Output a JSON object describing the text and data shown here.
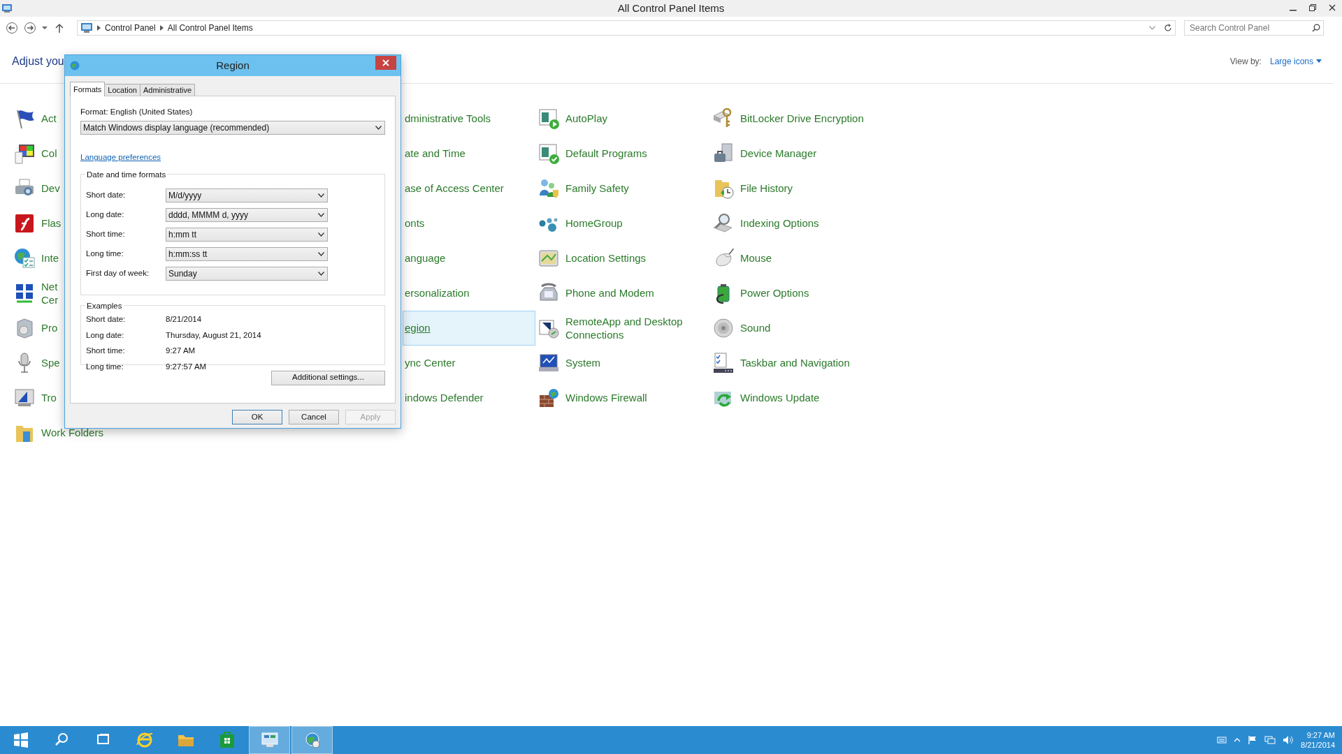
{
  "window": {
    "title": "All Control Panel Items"
  },
  "address_bar": {
    "breadcrumbs": [
      "Control Panel",
      "All Control Panel Items"
    ]
  },
  "search": {
    "placeholder": "Search Control Panel"
  },
  "header": {
    "title": "Adjust you",
    "view_by_label": "View by:",
    "view_by_value": "Large icons"
  },
  "columns": [
    {
      "kind": "full",
      "items": [
        {
          "label": "Act",
          "selected": false
        },
        {
          "label": "Col",
          "selected": false
        },
        {
          "label": "Dev",
          "selected": false
        },
        {
          "label": "Flas",
          "selected": false
        },
        {
          "label": "Inte",
          "selected": false
        },
        {
          "label": "Net\nCer",
          "selected": false
        },
        {
          "label": "Pro",
          "selected": false
        },
        {
          "label": "Spe",
          "selected": false
        },
        {
          "label": "Tro",
          "selected": false
        },
        {
          "label": "Work Folders",
          "selected": false
        }
      ]
    },
    {
      "kind": "covered",
      "items": [
        {
          "label": "dministrative Tools",
          "selected": false
        },
        {
          "label": "ate and Time",
          "selected": false
        },
        {
          "label": "ase of Access Center",
          "selected": false
        },
        {
          "label": "onts",
          "selected": false
        },
        {
          "label": "anguage",
          "selected": false
        },
        {
          "label": "ersonalization",
          "selected": false
        },
        {
          "label": "egion",
          "selected": true
        },
        {
          "label": "ync Center",
          "selected": false
        },
        {
          "label": "indows Defender",
          "selected": false
        }
      ]
    },
    {
      "kind": "full",
      "items": [
        {
          "label": "AutoPlay",
          "selected": false
        },
        {
          "label": "Default Programs",
          "selected": false
        },
        {
          "label": "Family Safety",
          "selected": false
        },
        {
          "label": "HomeGroup",
          "selected": false
        },
        {
          "label": "Location Settings",
          "selected": false
        },
        {
          "label": "Phone and Modem",
          "selected": false
        },
        {
          "label": "RemoteApp and Desktop Connections",
          "selected": false
        },
        {
          "label": "System",
          "selected": false
        },
        {
          "label": "Windows Firewall",
          "selected": false
        }
      ]
    },
    {
      "kind": "full",
      "items": [
        {
          "label": "BitLocker Drive Encryption",
          "selected": false
        },
        {
          "label": "Device Manager",
          "selected": false
        },
        {
          "label": "File History",
          "selected": false
        },
        {
          "label": "Indexing Options",
          "selected": false
        },
        {
          "label": "Mouse",
          "selected": false
        },
        {
          "label": "Power Options",
          "selected": false
        },
        {
          "label": "Sound",
          "selected": false
        },
        {
          "label": "Taskbar and Navigation",
          "selected": false
        },
        {
          "label": "Windows Update",
          "selected": false
        }
      ]
    }
  ],
  "dialog": {
    "title": "Region",
    "tabs": [
      {
        "label": "Formats",
        "selected": true
      },
      {
        "label": "Location",
        "selected": false
      },
      {
        "label": "Administrative",
        "selected": false
      }
    ],
    "format_label": "Format: English (United States)",
    "format_value": "Match Windows display language (recommended)",
    "link": "Language preferences",
    "formats_group": {
      "title": "Date and time formats",
      "rows": [
        {
          "label": "Short date:",
          "value": "M/d/yyyy"
        },
        {
          "label": "Long date:",
          "value": "dddd, MMMM d, yyyy"
        },
        {
          "label": "Short time:",
          "value": "h:mm tt"
        },
        {
          "label": "Long time:",
          "value": "h:mm:ss tt"
        },
        {
          "label": "First day of week:",
          "value": "Sunday"
        }
      ]
    },
    "examples_group": {
      "title": "Examples",
      "rows": [
        {
          "label": "Short date:",
          "value": "8/21/2014"
        },
        {
          "label": "Long date:",
          "value": "Thursday, August 21, 2014"
        },
        {
          "label": "Short time:",
          "value": "9:27 AM"
        },
        {
          "label": "Long time:",
          "value": "9:27:57 AM"
        }
      ]
    },
    "additional_button": "Additional settings...",
    "buttons": [
      {
        "label": "OK",
        "default": true,
        "disabled": false
      },
      {
        "label": "Cancel",
        "default": false,
        "disabled": false
      },
      {
        "label": "Apply",
        "default": false,
        "disabled": true
      }
    ]
  },
  "taskbar": {
    "apps": [
      {
        "selected": false
      },
      {
        "selected": false
      },
      {
        "selected": false
      },
      {
        "selected": false
      },
      {
        "selected": false
      },
      {
        "selected": false
      },
      {
        "selected": true
      },
      {
        "selected": true
      }
    ],
    "clock": {
      "time": "9:27 AM",
      "date": "8/21/2014"
    }
  }
}
